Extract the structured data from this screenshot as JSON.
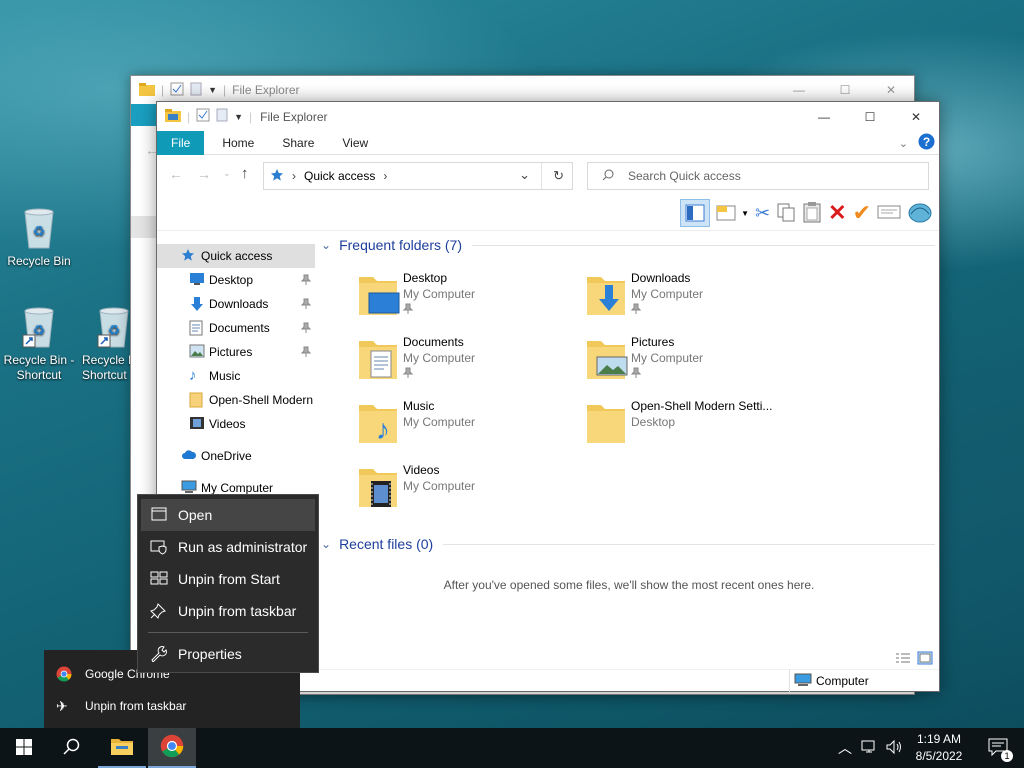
{
  "desktop": {
    "icons": [
      {
        "label": "Recycle Bin"
      },
      {
        "label": "Recycle Bin - Shortcut"
      },
      {
        "label": "Recycle Bin - Shortcut"
      }
    ]
  },
  "back_window": {
    "title": "File Explorer"
  },
  "window": {
    "title": "File Explorer",
    "tabs": [
      "File",
      "Home",
      "Share",
      "View"
    ],
    "address": {
      "location": "Quick access"
    },
    "search": {
      "placeholder": "Search Quick access"
    },
    "sidebar": {
      "items": [
        {
          "label": "Quick access",
          "icon": "star-icon",
          "pinned": false
        },
        {
          "label": "Desktop",
          "icon": "desktop-icon",
          "pinned": true
        },
        {
          "label": "Downloads",
          "icon": "download-icon",
          "pinned": true
        },
        {
          "label": "Documents",
          "icon": "document-icon",
          "pinned": true
        },
        {
          "label": "Pictures",
          "icon": "pictures-icon",
          "pinned": true
        },
        {
          "label": "Music",
          "icon": "music-icon",
          "pinned": false
        },
        {
          "label": "Open-Shell Modern",
          "icon": "folder-icon",
          "pinned": false
        },
        {
          "label": "Videos",
          "icon": "video-icon",
          "pinned": false
        },
        {
          "label": "OneDrive",
          "icon": "cloud-icon",
          "pinned": false
        },
        {
          "label": "My Computer",
          "icon": "computer-icon",
          "pinned": false
        }
      ]
    },
    "frequent": {
      "heading": "Frequent folders (7)",
      "folders": [
        {
          "name": "Desktop",
          "location": "My Computer",
          "pinned": true
        },
        {
          "name": "Downloads",
          "location": "My Computer",
          "pinned": true
        },
        {
          "name": "Documents",
          "location": "My Computer",
          "pinned": true
        },
        {
          "name": "Pictures",
          "location": "My Computer",
          "pinned": true
        },
        {
          "name": "Music",
          "location": "My Computer",
          "pinned": false
        },
        {
          "name": "Open-Shell Modern Setti...",
          "location": "Desktop",
          "pinned": false
        },
        {
          "name": "Videos",
          "location": "My Computer",
          "pinned": false
        }
      ]
    },
    "recent": {
      "heading": "Recent files (0)",
      "empty_text": "After you've opened some files, we'll show the most recent ones here."
    },
    "status": {
      "location": "Computer"
    }
  },
  "context_menu": {
    "items": [
      "Open",
      "Run as administrator",
      "Unpin from Start",
      "Unpin from taskbar",
      "Properties"
    ]
  },
  "jump_list": {
    "items": [
      "Google Chrome",
      "Unpin from taskbar"
    ]
  },
  "taskbar": {
    "time": "1:19 AM",
    "date": "8/5/2022",
    "notification_count": "1"
  },
  "colors": {
    "accent": "#0f9ab8",
    "heading": "#1e3f9c",
    "menu_bg": "#2b2b2b",
    "taskbar_bg": "#0d1417"
  }
}
